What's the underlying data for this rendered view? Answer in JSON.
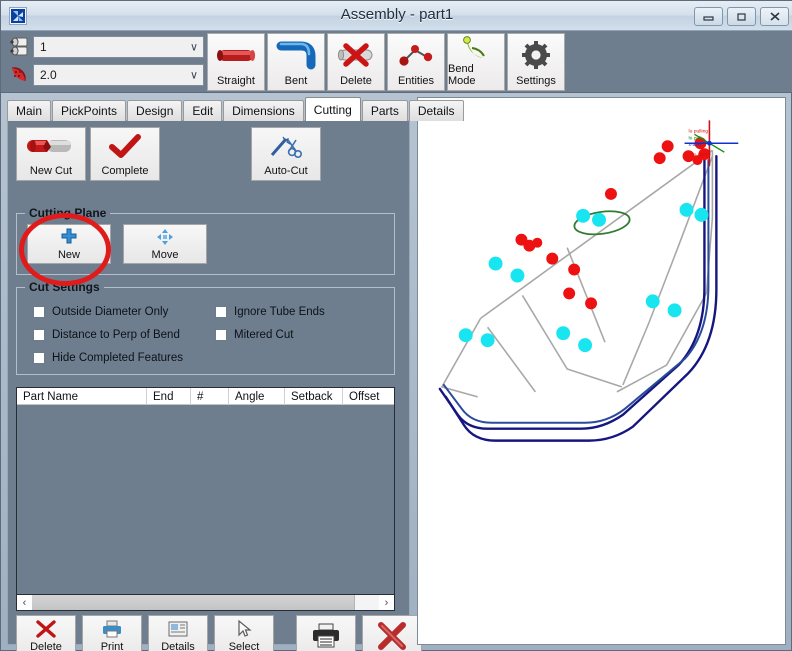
{
  "window": {
    "title": "Assembly - part1",
    "app_icon": "pinwheel-icon",
    "minimize_label": "–",
    "restore_label": "□",
    "close_label": "✕"
  },
  "toolbar": {
    "tube_select": {
      "icon": "roller-icon",
      "value": "1",
      "chevron": "∨"
    },
    "diameter_select": {
      "icon": "bend-die-icon",
      "value": "2.0",
      "chevron": "∨"
    },
    "buttons": [
      {
        "label": "Straight",
        "icon": "straight-tube-icon"
      },
      {
        "label": "Bent",
        "icon": "bent-tube-icon"
      },
      {
        "label": "Delete",
        "icon": "delete-tube-icon"
      },
      {
        "label": "Entities",
        "icon": "entities-icon"
      },
      {
        "label": "Bend Mode",
        "icon": "bend-mode-icon"
      },
      {
        "label": "Settings",
        "icon": "gear-icon"
      }
    ]
  },
  "tabs": [
    {
      "label": "Main",
      "active": false
    },
    {
      "label": "PickPoints",
      "active": false
    },
    {
      "label": "Design",
      "active": false
    },
    {
      "label": "Edit",
      "active": false
    },
    {
      "label": "Dimensions",
      "active": false
    },
    {
      "label": "Cutting",
      "active": true
    },
    {
      "label": "Parts",
      "active": false
    },
    {
      "label": "Details",
      "active": false
    }
  ],
  "cutting": {
    "actions": [
      {
        "label": "New Cut",
        "icon": "cut-tube-icon"
      },
      {
        "label": "Complete",
        "icon": "checkmark-icon"
      }
    ],
    "auto_cut": {
      "label": "Auto-Cut",
      "icon": "wand-scissors-icon"
    },
    "cutting_plane": {
      "title": "Cutting Plane",
      "buttons": [
        {
          "label": "New",
          "icon": "plus-icon"
        },
        {
          "label": "Move",
          "icon": "move-arrows-icon"
        }
      ]
    },
    "cut_settings": {
      "title": "Cut Settings",
      "options": [
        {
          "label": "Outside Diameter Only",
          "checked": false
        },
        {
          "label": "Ignore Tube Ends",
          "checked": false
        },
        {
          "label": "Distance to Perp of Bend",
          "checked": false
        },
        {
          "label": "Mitered Cut",
          "checked": false
        },
        {
          "label": "Hide Completed Features",
          "checked": false
        }
      ]
    },
    "table": {
      "columns": [
        "Part Name",
        "End",
        "#",
        "Angle",
        "Setback",
        "Offset"
      ],
      "rows": []
    },
    "scrollbar": {
      "left_arrow": "‹",
      "right_arrow": "›"
    },
    "bottom_buttons": [
      {
        "label": "Delete",
        "icon": "red-x-icon"
      },
      {
        "label": "Print",
        "icon": "printer-icon"
      },
      {
        "label": "Details",
        "icon": "details-icon"
      },
      {
        "label": "Select",
        "icon": "cursor-arrow-icon"
      },
      {
        "label": "",
        "icon": "printer-large-icon"
      },
      {
        "label": "",
        "icon": "red-x-large-icon"
      }
    ]
  },
  "annotation": {
    "shape": "ellipse",
    "color": "#e01b1b",
    "target": "New Cut button"
  },
  "viewport": {
    "name": "3d-tube-model",
    "background": "#ffffff",
    "colors": {
      "centerline": "#a8a8a8",
      "tube_outline": "#1a1a8c",
      "tube_outline_alt": "#2a4a8c",
      "node_cyan": "#19e5f0",
      "node_red": "#ee1111",
      "plane_ellipse": "#2f7d32",
      "axis_x": "#d01010",
      "axis_y": "#109010",
      "axis_z": "#1030d0"
    }
  }
}
